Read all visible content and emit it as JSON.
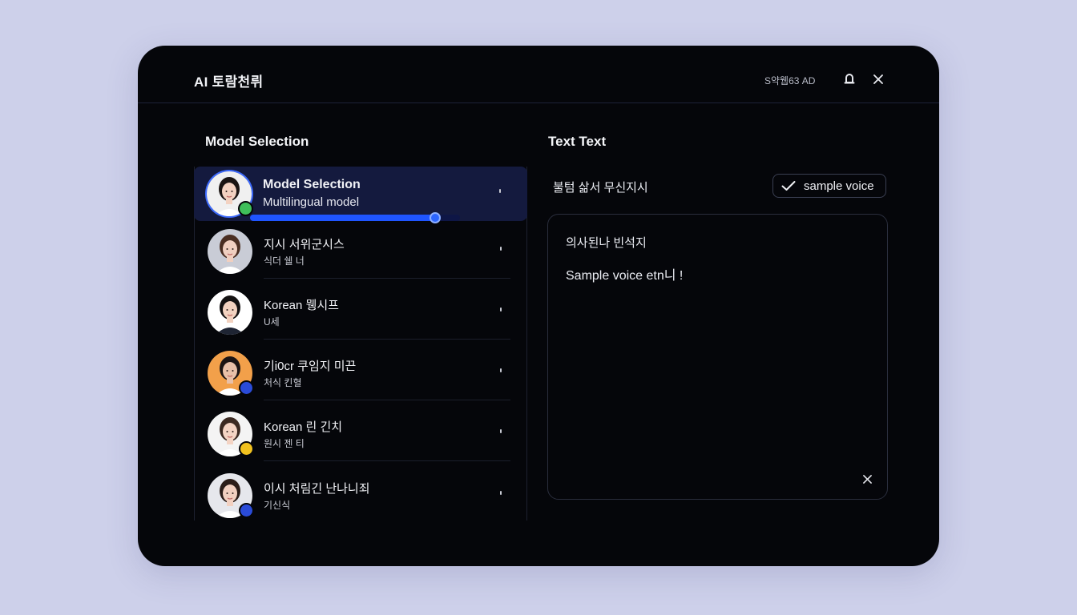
{
  "header": {
    "title": "AI 토람천뤼",
    "status": "S약웹63 AD",
    "bell_icon": "bell-icon",
    "close_icon": "close-icon"
  },
  "left": {
    "title": "Model Selection",
    "models": [
      {
        "name": "Model Selection",
        "sub": "Multilingual model",
        "badge_color": "#3fbf5a",
        "skin": "#f3d2c1",
        "hair": "#1a1412",
        "bg": "#f0f0f0",
        "progress": 0.88
      },
      {
        "name": "지시 서위군시스",
        "sub": "식더 쉘 너",
        "badge_color": "",
        "skin": "#f0cfc0",
        "hair": "#4a2e22",
        "bg": "#c9ccd6"
      },
      {
        "name": "Korean 뮁시프",
        "sub": "U세",
        "badge_color": "",
        "skin": "#f2d2c0",
        "hair": "#141212",
        "bg": "#ffffff"
      },
      {
        "name": "기i0cr 쿠임지 미끈",
        "sub": "처식 킨혈",
        "badge_color": "#2a4bd8",
        "skin": "#e8c0a8",
        "hair": "#1b1414",
        "bg": "#f2a04a"
      },
      {
        "name": "Korean 린 긴치",
        "sub": "원시 젠 티",
        "badge_color": "#f2c21f",
        "skin": "#f4d4c4",
        "hair": "#3c2a22",
        "bg": "#f4f4f4"
      },
      {
        "name": "이시 처림긴 난나니죄",
        "sub": "기신식",
        "badge_color": "#2a4bd8",
        "skin": "#f2d0c0",
        "hair": "#2b1d18",
        "bg": "#e6e7ec"
      }
    ]
  },
  "right": {
    "title": "Text Text",
    "label": "불텀 삶서 무신지시",
    "sample_button": "sample voice",
    "check_icon": "check-icon",
    "panel_heading": "의사된나 빈석지",
    "panel_text": "Sample voice etn니 !",
    "clear_icon": "close-icon"
  }
}
